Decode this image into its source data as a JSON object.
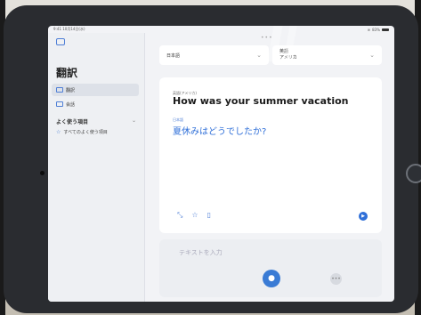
{
  "statusbar": {
    "time": "9:41 10月14日(水)",
    "battery": "83%"
  },
  "sidebar": {
    "title": "翻訳",
    "items": [
      {
        "label": "翻訳",
        "active": true
      },
      {
        "label": "会話",
        "active": false
      }
    ],
    "favorites_header": "よく使う項目",
    "favorites_item": "すべてのよく使う項目"
  },
  "main": {
    "source_language": "日本語",
    "target_language_line1": "英語",
    "target_language_line2": "アメリカ",
    "source_label": "英語(アメリカ)",
    "source_text": "How was your summer vacation",
    "target_label": "日本語",
    "target_text": "夏休みはどうでしたか?",
    "input_placeholder": "テキストを入力"
  },
  "colors": {
    "accent": "#2f6fd8",
    "bezel": "#2a2c30"
  }
}
